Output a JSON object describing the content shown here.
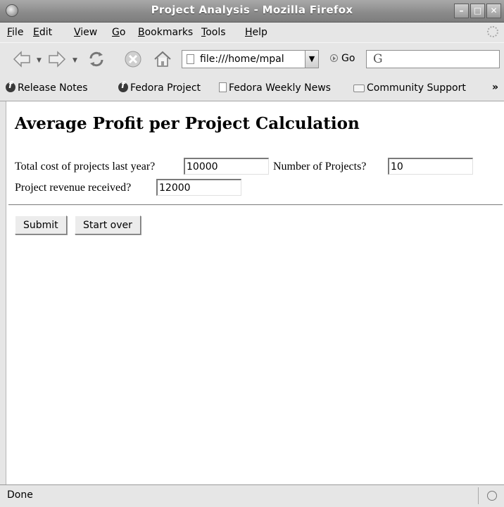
{
  "window": {
    "title": "Project Analysis - Mozilla Firefox"
  },
  "menu": [
    "File",
    "Edit",
    "View",
    "Go",
    "Bookmarks",
    "Tools",
    "Help"
  ],
  "menu_mnemonics": [
    "F",
    "E",
    "V",
    "G",
    "B",
    "T",
    "H"
  ],
  "toolbar": {
    "url": "file:///home/mpal",
    "go_label": "Go",
    "search_glyph": "G"
  },
  "bookmarks": [
    {
      "label": "Release Notes",
      "icon": "fedora-icon"
    },
    {
      "label": "Fedora Project",
      "icon": "fedora-icon"
    },
    {
      "label": "Fedora Weekly News",
      "icon": "page-icon"
    },
    {
      "label": "Community Support",
      "icon": "folder-icon"
    }
  ],
  "bookmarks_overflow": "»",
  "page": {
    "heading": "Average Profit per Project Calculation",
    "fields": {
      "total_cost": {
        "label": "Total cost of projects last year?",
        "value": "10000"
      },
      "num_projects": {
        "label": "Number of Projects?",
        "value": "10"
      },
      "revenue": {
        "label": "Project revenue received?",
        "value": "12000"
      }
    },
    "buttons": {
      "submit": "Submit",
      "reset": "Start over"
    }
  },
  "status": {
    "text": "Done"
  }
}
